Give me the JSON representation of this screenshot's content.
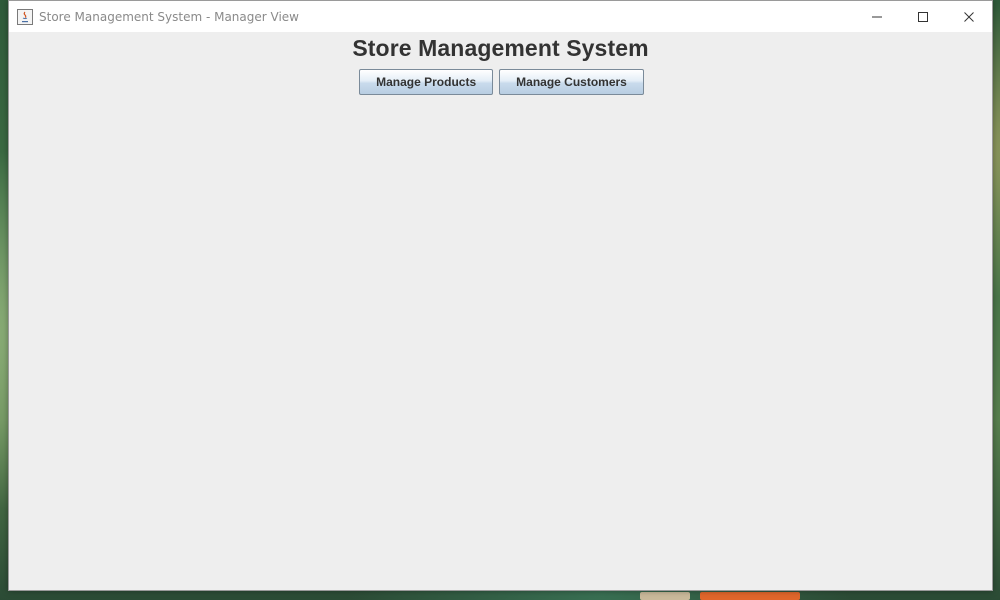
{
  "window": {
    "title": "Store Management System - Manager View",
    "icon": "java-app-icon",
    "controls": {
      "minimize_icon": "minimize-icon",
      "maximize_icon": "maximize-icon",
      "close_icon": "close-icon"
    }
  },
  "main": {
    "heading": "Store Management System",
    "buttons": [
      {
        "label": "Manage Products"
      },
      {
        "label": "Manage Customers"
      }
    ]
  },
  "colors": {
    "window_background": "#eeeeee",
    "titlebar_background": "#ffffff",
    "heading_text": "#333333"
  }
}
